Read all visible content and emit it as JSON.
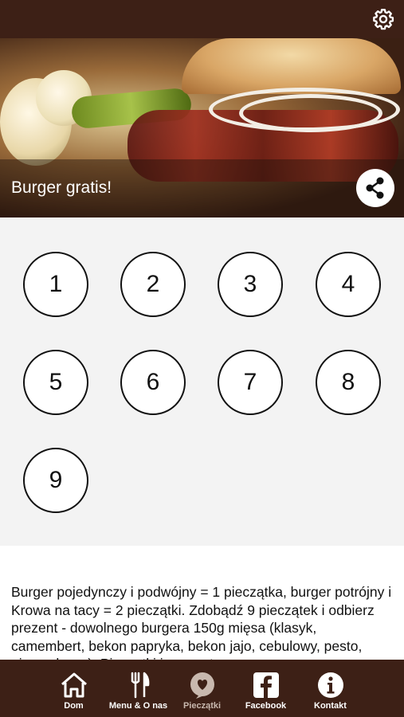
{
  "hero": {
    "title": "Burger gratis!"
  },
  "stamps": [
    "1",
    "2",
    "3",
    "4",
    "5",
    "6",
    "7",
    "8",
    "9"
  ],
  "description": "Burger pojedynczy i podwójny = 1 pieczątka, burger potrójny i Krowa na tacy = 2 pieczątki. Zdobądź 9 pieczątek i odbierz prezent - dowolnego burgera 150g mięsa (klasyk, camembert, bekon papryka, bekon jajo, cebulowy, pesto, pieczarkowy). Pieczątki i prezenty",
  "tabs": [
    {
      "label": "Dom",
      "icon": "home-icon"
    },
    {
      "label": "Menu & O nas",
      "icon": "fork-knife-icon"
    },
    {
      "label": "Pieczątki",
      "icon": "heart-bubble-icon",
      "active": true
    },
    {
      "label": "Facebook",
      "icon": "facebook-icon"
    },
    {
      "label": "Kontakt",
      "icon": "info-icon"
    }
  ],
  "colors": {
    "bar": "#3d2016",
    "active_tab": "#c8b8ae",
    "stamp_area": "#f3f3f3"
  }
}
